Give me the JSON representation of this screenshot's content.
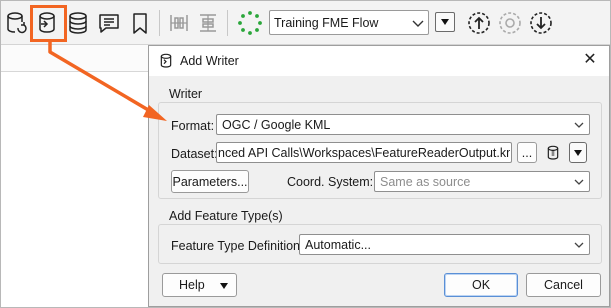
{
  "toolbar": {
    "flow_select_value": "Training FME Flow",
    "icons": [
      "read-data-icon",
      "add-writer-icon",
      "feature-types-icon",
      "annotation-icon",
      "bookmark-icon",
      "distribute-horizontal-icon",
      "distribute-vertical-icon",
      "flow-status-icon",
      "publish-icon",
      "flow-sync-icon",
      "download-icon"
    ],
    "accent": "#f26522"
  },
  "dialog": {
    "title": "Add Writer",
    "close": "✕",
    "writer_group": "Writer",
    "format_label": "Format:",
    "format_value": "OGC / Google KML",
    "dataset_label": "Dataset:",
    "dataset_value": "nced API Calls\\Workspaces\\FeatureReaderOutput.kml\"",
    "browse_label": "...",
    "parameters_label": "Parameters...",
    "coord_label": "Coord. System:",
    "coord_placeholder": "Same as source",
    "feature_group": "Add Feature Type(s)",
    "ftd_label": "Feature Type Definition:",
    "ftd_value": "Automatic...",
    "help_label": "Help",
    "ok_label": "OK",
    "cancel_label": "Cancel"
  }
}
